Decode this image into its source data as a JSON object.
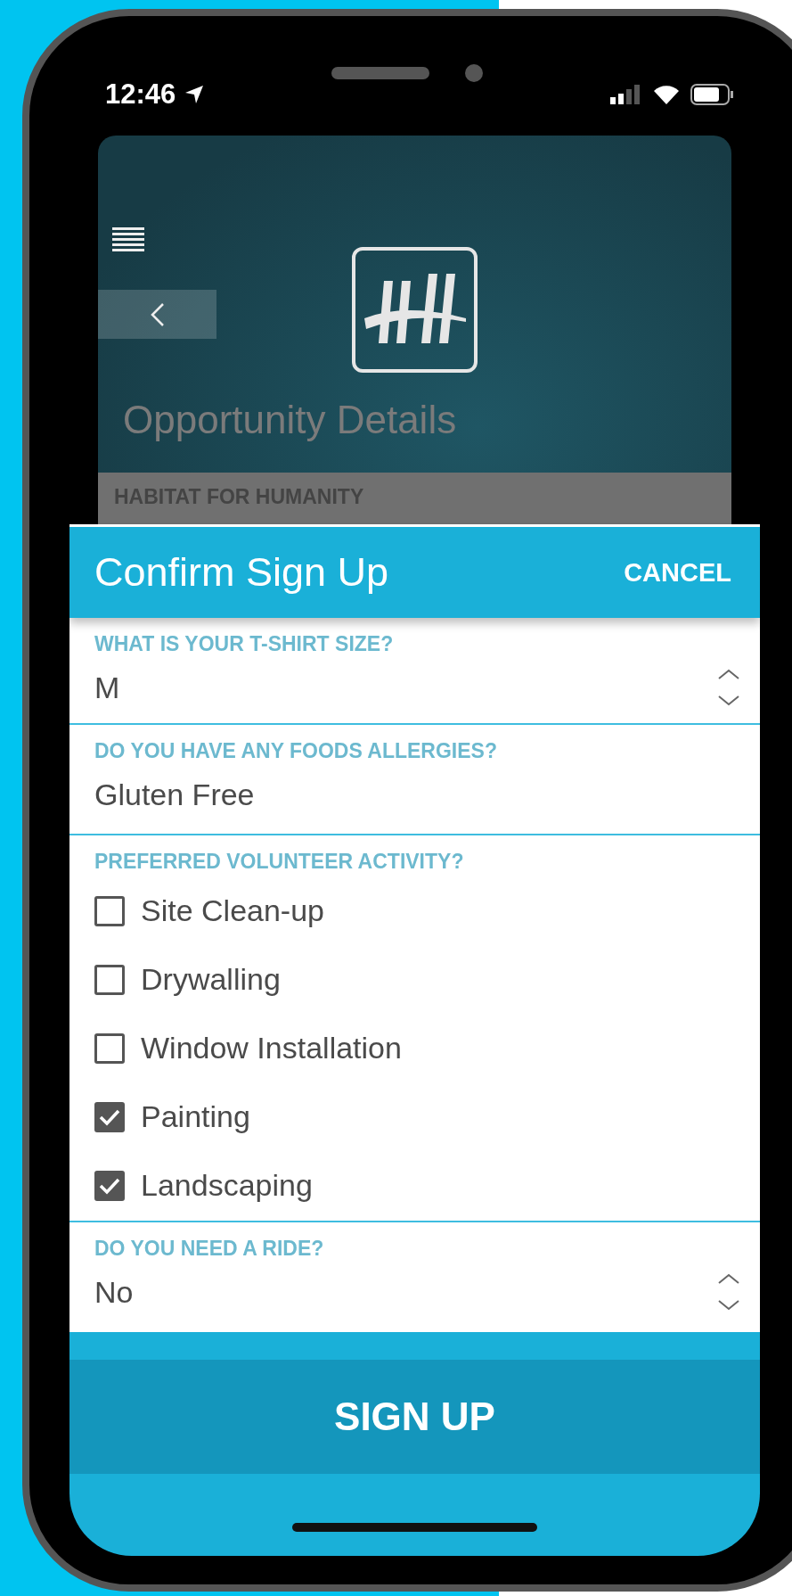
{
  "status_bar": {
    "time": "12:46"
  },
  "background_page": {
    "title": "Opportunity Details",
    "organization": "HABITAT FOR HUMANITY"
  },
  "dialog": {
    "title": "Confirm Sign Up",
    "cancel": "CANCEL",
    "fields": [
      {
        "kind": "select",
        "label": "WHAT IS YOUR T-SHIRT SIZE?",
        "value": "M"
      },
      {
        "kind": "text",
        "label": "DO YOU HAVE ANY FOODS ALLERGIES?",
        "value": "Gluten Free"
      },
      {
        "kind": "checklist",
        "label": "PREFERRED VOLUNTEER ACTIVITY?",
        "options": [
          {
            "label": "Site Clean-up",
            "checked": false
          },
          {
            "label": "Drywalling",
            "checked": false
          },
          {
            "label": "Window Installation",
            "checked": false
          },
          {
            "label": "Painting",
            "checked": true
          },
          {
            "label": "Landscaping",
            "checked": true
          }
        ]
      },
      {
        "kind": "select",
        "label": "DO YOU NEED A RIDE?",
        "value": "No"
      }
    ],
    "submit": "SIGN UP"
  }
}
